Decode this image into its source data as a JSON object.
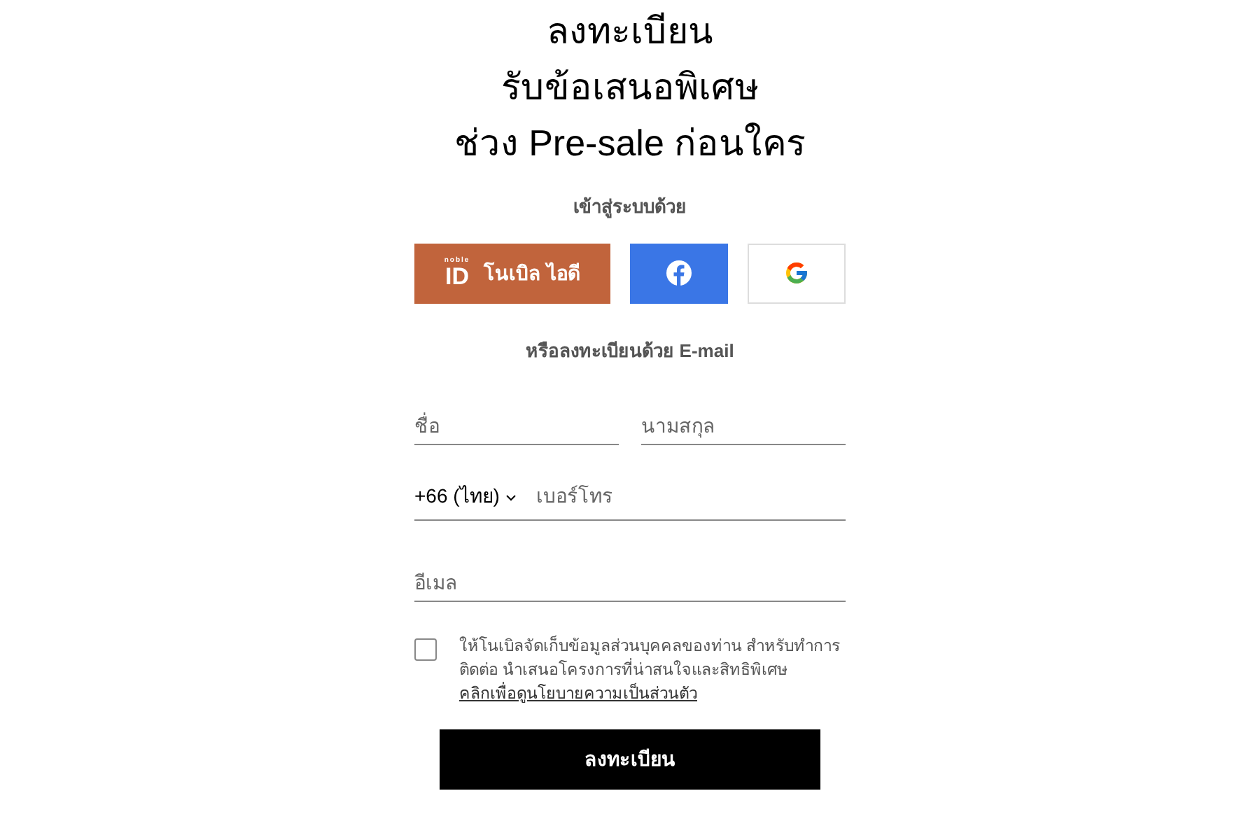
{
  "heading": [
    "ลงทะเบียน",
    "รับข้อเสนอพิเศษ",
    "ช่วง Pre-sale ก่อนใคร"
  ],
  "login_label": "เข้าสู่ระบบด้วย",
  "login_buttons": [
    {
      "kind": "noble",
      "logo_small": "noble",
      "logo_id": "ID",
      "label": "โนเบิล ไอดี"
    },
    {
      "kind": "facebook"
    },
    {
      "kind": "google"
    }
  ],
  "email_label": "หรือลงทะเบียนด้วย E-mail",
  "first_name": {
    "placeholder": "ชื่อ"
  },
  "last_name": {
    "placeholder": "นามสกุล"
  },
  "phone": {
    "country": "+66 (ไทย)",
    "placeholder": "เบอร์โทร"
  },
  "email": {
    "placeholder": "อีเมล"
  },
  "consent": {
    "checked": false,
    "text": "ให้โนเบิลจัดเก็บข้อมูลส่วนบุคคลของท่าน สำหรับทำการติดต่อ นำเสนอโครงการที่น่าสนใจและสิทธิพิเศษ",
    "link": "คลิกเพื่อดูนโยบายความเป็นส่วนตัว"
  },
  "submit": "ลงทะเบียน"
}
